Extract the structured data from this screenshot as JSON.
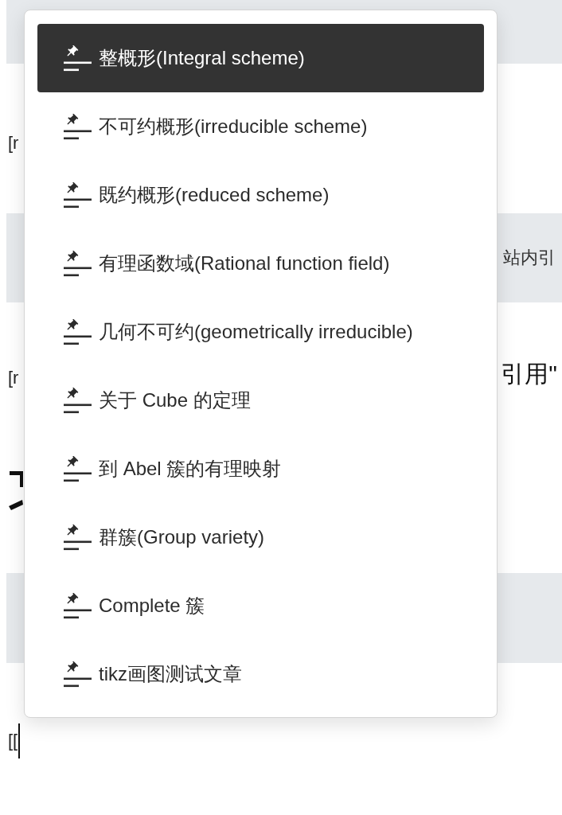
{
  "document": {
    "line_1": "[r",
    "shaded_line_2": "站内引",
    "line_3_left": "[r",
    "line_3_right": "引用\"",
    "editor_line": "[["
  },
  "dropdown": {
    "items": [
      {
        "label": "整概形(Integral scheme)",
        "selected": true
      },
      {
        "label": "不可约概形(irreducible scheme)",
        "selected": false
      },
      {
        "label": "既约概形(reduced scheme)",
        "selected": false
      },
      {
        "label": "有理函数域(Rational function field)",
        "selected": false
      },
      {
        "label": "几何不可约(geometrically irreducible)",
        "selected": false
      },
      {
        "label": "关于 Cube 的定理",
        "selected": false
      },
      {
        "label": "到 Abel 簇的有理映射",
        "selected": false
      },
      {
        "label": "群簇(Group variety)",
        "selected": false
      },
      {
        "label": "Complete 簇",
        "selected": false
      },
      {
        "label": "tikz画图测试文章",
        "selected": false
      }
    ]
  }
}
